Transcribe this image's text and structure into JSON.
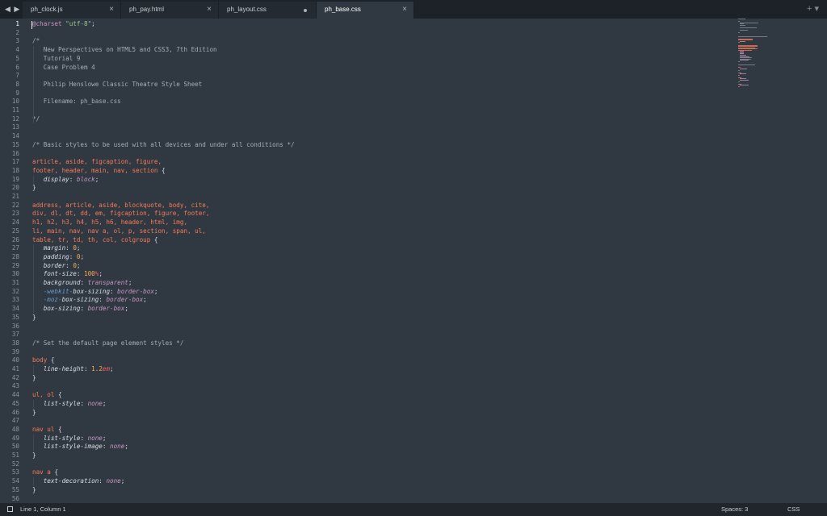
{
  "tabs": [
    {
      "label": "ph_clock.js",
      "state": "close"
    },
    {
      "label": "ph_pay.html",
      "state": "close"
    },
    {
      "label": "ph_layout.css",
      "state": "dirty"
    },
    {
      "label": "ph_base.css",
      "state": "close",
      "active": true
    }
  ],
  "tab_tools": "+ ▾",
  "nav_arrows": "◀ ▶",
  "editor": {
    "current_line": 1,
    "lines": [
      [
        [
          "at",
          "@charset "
        ],
        [
          "str",
          "\"utf-8\""
        ],
        [
          "",
          "; "
        ]
      ],
      [],
      [
        [
          "com",
          "/*"
        ]
      ],
      [
        [
          "com",
          "   New Perspectives on HTML5 and CSS3, 7th Edition"
        ]
      ],
      [
        [
          "com",
          "   Tutorial 9"
        ]
      ],
      [
        [
          "com",
          "   Case Problem 4"
        ]
      ],
      [],
      [
        [
          "com",
          "   Philip Henslowe Classic Theatre Style Sheet"
        ]
      ],
      [],
      [
        [
          "com",
          "   Filename: ph_base.css"
        ]
      ],
      [],
      [
        [
          "com",
          "*/"
        ]
      ],
      [],
      [],
      [
        [
          "com",
          "/* Basic styles to be used with all devices and under all conditions */"
        ]
      ],
      [],
      [
        [
          "sel",
          "article, aside, figcaption, figure,"
        ]
      ],
      [
        [
          "sel",
          "footer, header, main, nav, section "
        ],
        [
          "",
          "{"
        ]
      ],
      [
        [
          "",
          "   "
        ],
        [
          "prop",
          "display"
        ],
        [
          "",
          ": "
        ],
        [
          "val",
          "block"
        ],
        [
          "",
          ";"
        ]
      ],
      [
        [
          "",
          "}"
        ]
      ],
      [],
      [
        [
          "sel",
          "address, article, aside, blockquote, body, cite,"
        ]
      ],
      [
        [
          "sel",
          "div, dl, dt, dd, em, figcaption, figure, footer,"
        ]
      ],
      [
        [
          "sel",
          "h1, h2, h3, h4, h5, h6, header, html, img,"
        ]
      ],
      [
        [
          "sel",
          "li, main, nav, nav a, ol, p, section, span, ul,"
        ]
      ],
      [
        [
          "sel",
          "table, tr, td, th, col, colgroup "
        ],
        [
          "",
          "{"
        ]
      ],
      [
        [
          "",
          "   "
        ],
        [
          "prop",
          "margin"
        ],
        [
          "",
          ": "
        ],
        [
          "num",
          "0"
        ],
        [
          "",
          ";"
        ]
      ],
      [
        [
          "",
          "   "
        ],
        [
          "prop",
          "padding"
        ],
        [
          "",
          ": "
        ],
        [
          "num",
          "0"
        ],
        [
          "",
          ";"
        ]
      ],
      [
        [
          "",
          "   "
        ],
        [
          "prop",
          "border"
        ],
        [
          "",
          ": "
        ],
        [
          "num",
          "0"
        ],
        [
          "",
          ";"
        ]
      ],
      [
        [
          "",
          "   "
        ],
        [
          "prop",
          "font-size"
        ],
        [
          "",
          ": "
        ],
        [
          "num",
          "100"
        ],
        [
          "unit",
          "%"
        ],
        [
          "",
          ";"
        ]
      ],
      [
        [
          "",
          "   "
        ],
        [
          "prop",
          "background"
        ],
        [
          "",
          ": "
        ],
        [
          "val",
          "transparent"
        ],
        [
          "",
          ";"
        ]
      ],
      [
        [
          "",
          "   "
        ],
        [
          "vendor",
          "-webkit-"
        ],
        [
          "prop",
          "box-sizing"
        ],
        [
          "",
          ": "
        ],
        [
          "val",
          "border-box"
        ],
        [
          "",
          ";"
        ]
      ],
      [
        [
          "",
          "   "
        ],
        [
          "vendor",
          "-moz-"
        ],
        [
          "prop",
          "box-sizing"
        ],
        [
          "",
          ": "
        ],
        [
          "val",
          "border-box"
        ],
        [
          "",
          ";"
        ]
      ],
      [
        [
          "",
          "   "
        ],
        [
          "prop",
          "box-sizing"
        ],
        [
          "",
          ": "
        ],
        [
          "val",
          "border-box"
        ],
        [
          "",
          ";"
        ]
      ],
      [
        [
          "",
          "}"
        ]
      ],
      [],
      [],
      [
        [
          "com",
          "/* Set the default page element styles */"
        ]
      ],
      [],
      [
        [
          "sel",
          "body "
        ],
        [
          "",
          "{"
        ]
      ],
      [
        [
          "",
          "   "
        ],
        [
          "prop",
          "line-height"
        ],
        [
          "",
          ": "
        ],
        [
          "num",
          "1.2"
        ],
        [
          "unit",
          "em"
        ],
        [
          "",
          ";"
        ]
      ],
      [
        [
          "",
          "}"
        ]
      ],
      [],
      [
        [
          "sel",
          "ul, ol "
        ],
        [
          "",
          "{"
        ]
      ],
      [
        [
          "",
          "   "
        ],
        [
          "prop",
          "list-style"
        ],
        [
          "",
          ": "
        ],
        [
          "val",
          "none"
        ],
        [
          "",
          ";"
        ]
      ],
      [
        [
          "",
          "}"
        ]
      ],
      [],
      [
        [
          "sel",
          "nav ul "
        ],
        [
          "",
          "{"
        ]
      ],
      [
        [
          "",
          "   "
        ],
        [
          "prop",
          "list-style"
        ],
        [
          "",
          ": "
        ],
        [
          "val",
          "none"
        ],
        [
          "",
          ";"
        ]
      ],
      [
        [
          "",
          "   "
        ],
        [
          "prop",
          "list-style-image"
        ],
        [
          "",
          ": "
        ],
        [
          "val",
          "none"
        ],
        [
          "",
          ";"
        ]
      ],
      [
        [
          "",
          "}"
        ]
      ],
      [],
      [
        [
          "sel",
          "nav a "
        ],
        [
          "",
          "{"
        ]
      ],
      [
        [
          "",
          "   "
        ],
        [
          "prop",
          "text-decoration"
        ],
        [
          "",
          ": "
        ],
        [
          "val",
          "none"
        ],
        [
          "",
          ";"
        ]
      ],
      [
        [
          "",
          "}"
        ]
      ],
      []
    ]
  },
  "statusbar": {
    "position": "Line 1, Column 1",
    "spaces": "Spaces: 3",
    "syntax": "CSS"
  },
  "colors": {
    "background": "#303841",
    "selector": "#f97b58",
    "comment": "#a6acb9",
    "value": "#c695c6",
    "number": "#f9ae58",
    "string": "#99c794"
  }
}
